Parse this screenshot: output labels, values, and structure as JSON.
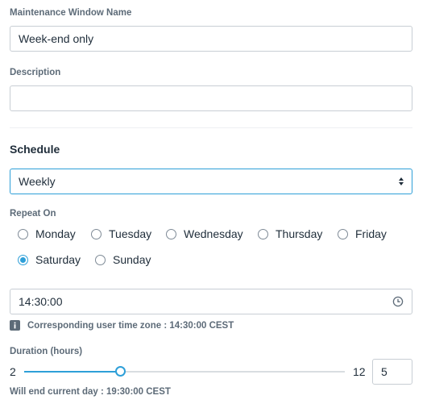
{
  "form": {
    "name_label": "Maintenance Window Name",
    "name_value": "Week-end only",
    "description_label": "Description",
    "description_value": "",
    "schedule_title": "Schedule",
    "schedule_value": "Weekly",
    "repeat_on_label": "Repeat On",
    "days": [
      {
        "label": "Monday",
        "checked": false
      },
      {
        "label": "Tuesday",
        "checked": false
      },
      {
        "label": "Wednesday",
        "checked": false
      },
      {
        "label": "Thursday",
        "checked": false
      },
      {
        "label": "Friday",
        "checked": false
      },
      {
        "label": "Saturday",
        "checked": true
      },
      {
        "label": "Sunday",
        "checked": false
      }
    ],
    "time_value": "14:30:00",
    "timezone_hint": "Corresponding user time zone : 14:30:00 CEST",
    "duration_label": "Duration (hours)",
    "duration_min": "2",
    "duration_max": "12",
    "duration_value": "5",
    "end_hint": "Will end current day : 19:30:00 CEST"
  },
  "slider": {
    "min": 2,
    "max": 12,
    "value": 5
  },
  "colors": {
    "accent": "#2e9fd8",
    "label": "#5d6b78",
    "border": "#c8ced4"
  },
  "icons": {
    "select": "updown-arrows-icon",
    "time": "clock-icon",
    "hint": "info-icon"
  }
}
